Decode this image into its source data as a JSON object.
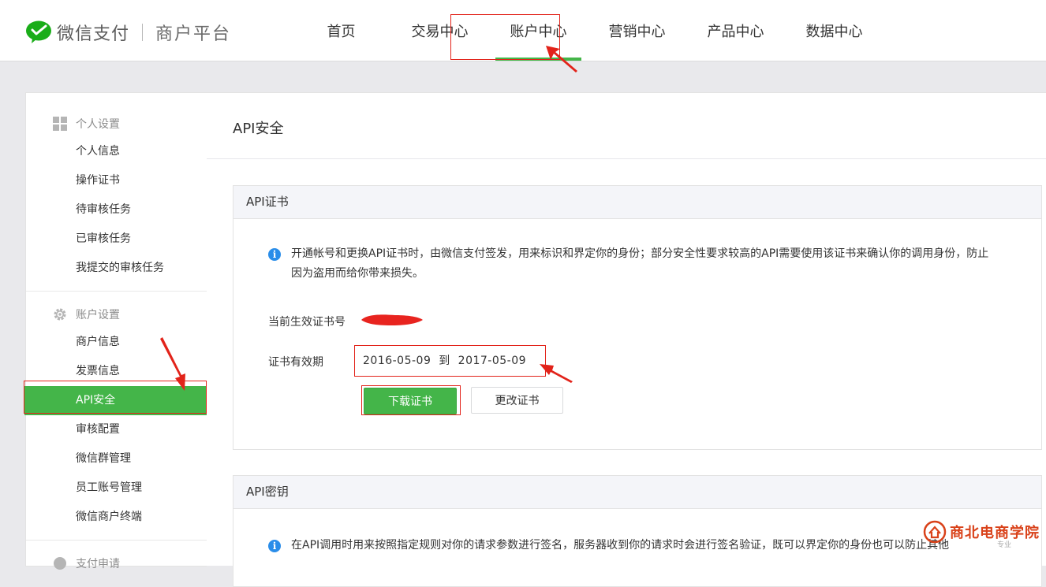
{
  "brand": {
    "name": "微信支付",
    "platform": "商户平台"
  },
  "nav": [
    "首页",
    "交易中心",
    "账户中心",
    "营销中心",
    "产品中心",
    "数据中心"
  ],
  "nav_active": "账户中心",
  "sidebar": {
    "personal": {
      "title": "个人设置",
      "icon": "grid-icon",
      "items": [
        "个人信息",
        "操作证书",
        "待审核任务",
        "已审核任务",
        "我提交的审核任务"
      ]
    },
    "account": {
      "title": "账户设置",
      "icon": "gear-icon",
      "items": [
        "商户信息",
        "发票信息",
        "API安全",
        "审核配置",
        "微信群管理",
        "员工账号管理",
        "微信商户终端"
      ],
      "active": "API安全"
    },
    "payment": {
      "title": "支付申请",
      "icon": "pay-icon"
    }
  },
  "page": {
    "title": "API安全"
  },
  "cert_panel": {
    "title": "API证书",
    "notice": "开通帐号和更换API证书时，由微信支付签发，用来标识和界定你的身份；部分安全性要求较高的API需要使用该证书来确认你的调用身份，防止因为盗用而给你带来损失。",
    "current_label": "当前生效证书号",
    "validity_label": "证书有效期",
    "validity_value": "2016-05-09  到  2017-05-09",
    "download_label": "下载证书",
    "change_label": "更改证书"
  },
  "key_panel": {
    "title": "API密钥",
    "notice": "在API调用时用来按照指定规则对你的请求参数进行签名，服务器收到你的请求时会进行签名验证，既可以界定你的身份也可以防止其他"
  },
  "watermark": {
    "text": "商北电商学院",
    "sub": "专业"
  },
  "colors": {
    "accent": "#44b549",
    "info": "#2a8de9",
    "annotation": "#e2231a"
  }
}
